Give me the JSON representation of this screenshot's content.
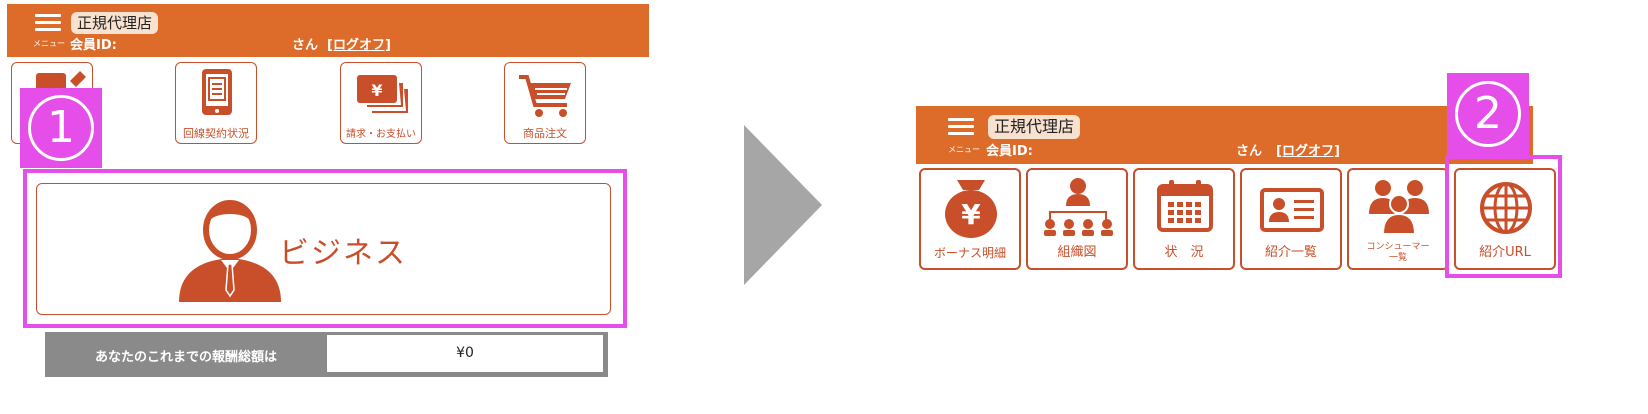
{
  "left": {
    "header": {
      "menu_label": "メニュー",
      "shop_badge": "正規代理店",
      "member_id_label": "会員ID:",
      "san": "さん",
      "logoff": "[ログオフ]"
    },
    "tiles": [
      {
        "label": "",
        "icon": "edit-icon"
      },
      {
        "label": "回線契約状況",
        "icon": "tablet-document-icon"
      },
      {
        "label": "請求・お支払い",
        "icon": "yen-money-icon"
      },
      {
        "label": "商品注文",
        "icon": "cart-icon"
      }
    ],
    "marker": "1",
    "business_button_label": "ビジネス",
    "total_label": "あなたのこれまでの報酬総額は",
    "total_value": "¥0"
  },
  "right": {
    "header": {
      "menu_label": "メニュー",
      "shop_badge": "正規代理店",
      "member_id_label": "会員ID:",
      "san": "さん",
      "logoff": "[ログオフ]"
    },
    "tiles": [
      {
        "label": "ボーナス明細",
        "icon": "yen-bag-icon"
      },
      {
        "label": "組織図",
        "icon": "org-chart-icon"
      },
      {
        "label": "状　況",
        "icon": "calendar-icon"
      },
      {
        "label": "紹介一覧",
        "icon": "id-card-icon"
      },
      {
        "label_line1": "コンシューマー",
        "label_line2": "一覧",
        "icon": "group-icon"
      },
      {
        "label": "紹介URL",
        "icon": "globe-icon"
      }
    ],
    "marker": "2"
  },
  "colors": {
    "header": "#dd6b2a",
    "accent": "#c94f2a",
    "highlight": "#e54ee8",
    "arrow": "#a6a6a6",
    "total_bar": "#8a8a8a"
  }
}
